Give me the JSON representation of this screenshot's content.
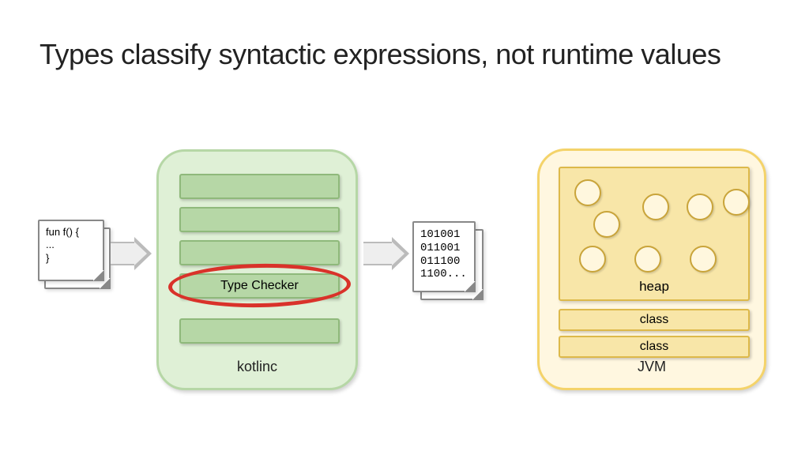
{
  "title": "Types classify syntactic expressions, not runtime values",
  "source": {
    "line1": "fun f() {",
    "line2": "  ...",
    "line3": "}"
  },
  "kotlinc": {
    "label": "kotlinc",
    "typeChecker": "Type Checker"
  },
  "binary": {
    "line1": "101001",
    "line2": "011001",
    "line3": "011100",
    "line4": "1100..."
  },
  "jvm": {
    "label": "JVM",
    "heap": "heap",
    "class1": "class",
    "class2": "class"
  }
}
